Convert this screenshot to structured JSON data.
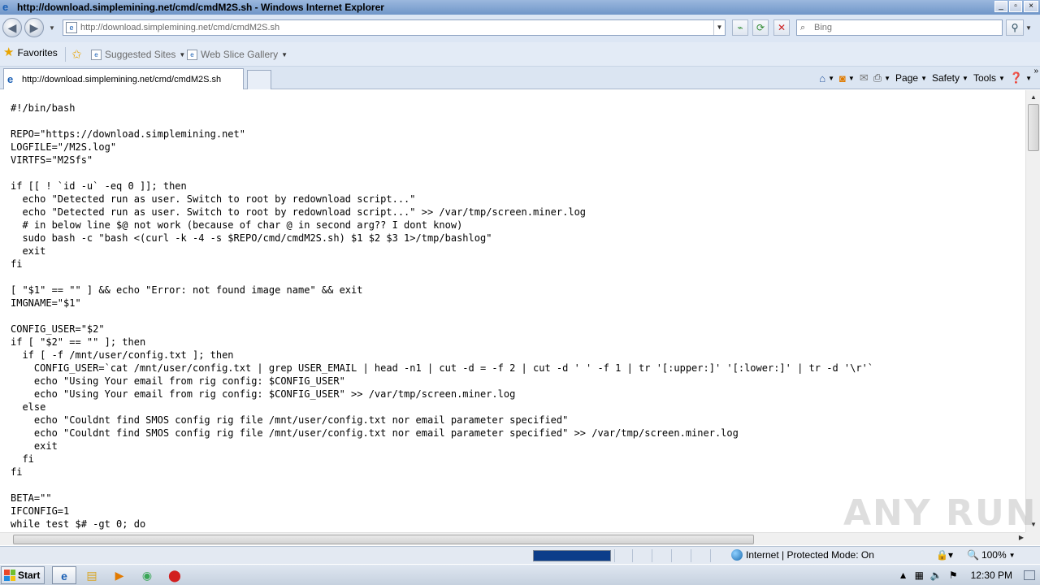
{
  "window": {
    "title": "http://download.simplemining.net/cmd/cmdM2S.sh - Windows Internet Explorer",
    "controls": [
      "_",
      "▫",
      "×"
    ]
  },
  "address_bar": {
    "url": "http://download.simplemining.net/cmd/cmdM2S.sh",
    "search_placeholder": "Bing"
  },
  "favorites_bar": {
    "favorites_label": "Favorites",
    "items": [
      {
        "label": "Suggested Sites"
      },
      {
        "label": "Web Slice Gallery"
      }
    ]
  },
  "tab": {
    "label": "http://download.simplemining.net/cmd/cmdM2S.sh"
  },
  "command_bar": {
    "page_label": "Page",
    "safety_label": "Safety",
    "tools_label": "Tools"
  },
  "content": {
    "lines": [
      "#!/bin/bash",
      "",
      "REPO=\"https://download.simplemining.net\"",
      "LOGFILE=\"/M2S.log\"",
      "VIRTFS=\"M2Sfs\"",
      "",
      "if [[ ! `id -u` -eq 0 ]]; then",
      "  echo \"Detected run as user. Switch to root by redownload script...\"",
      "  echo \"Detected run as user. Switch to root by redownload script...\" >> /var/tmp/screen.miner.log",
      "  # in below line $@ not work (because of char @ in second arg?? I dont know)",
      "  sudo bash -c \"bash <(curl -k -4 -s $REPO/cmd/cmdM2S.sh) $1 $2 $3 1>/tmp/bashlog\"",
      "  exit",
      "fi",
      "",
      "[ \"$1\" == \"\" ] && echo \"Error: not found image name\" && exit",
      "IMGNAME=\"$1\"",
      "",
      "CONFIG_USER=\"$2\"",
      "if [ \"$2\" == \"\" ]; then",
      "  if [ -f /mnt/user/config.txt ]; then",
      "    CONFIG_USER=`cat /mnt/user/config.txt | grep USER_EMAIL | head -n1 | cut -d = -f 2 | cut -d ' ' -f 1 | tr '[:upper:]' '[:lower:]' | tr -d '\\r'`",
      "    echo \"Using Your email from rig config: $CONFIG_USER\"",
      "    echo \"Using Your email from rig config: $CONFIG_USER\" >> /var/tmp/screen.miner.log",
      "  else",
      "    echo \"Couldnt find SMOS config rig file /mnt/user/config.txt nor email parameter specified\"",
      "    echo \"Couldnt find SMOS config rig file /mnt/user/config.txt nor email parameter specified\" >> /var/tmp/screen.miner.log",
      "    exit",
      "  fi",
      "fi",
      "",
      "BETA=\"\"",
      "IFCONFIG=1",
      "while test $# -gt 0; do"
    ]
  },
  "status_bar": {
    "zone": "Internet | Protected Mode: On",
    "zoom": "100%",
    "progress": 1.0
  },
  "watermark": "ANY RUN",
  "taskbar": {
    "start_label": "Start",
    "clock": "12:30 PM"
  }
}
